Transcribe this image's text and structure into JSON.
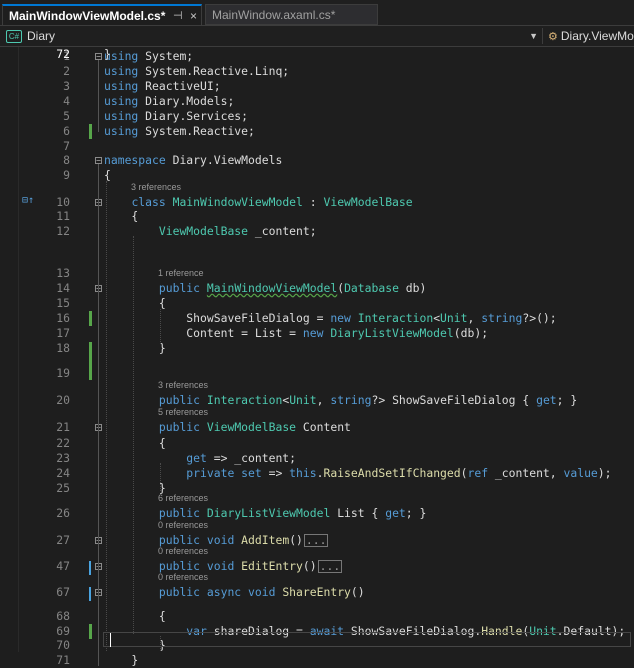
{
  "tabs": [
    {
      "title": "MainWindowViewModel.cs*",
      "pin": "⊣",
      "close": "×"
    },
    {
      "title": "MainWindow.axaml.cs*"
    }
  ],
  "nav": {
    "project": "Diary",
    "project_icon": "C#",
    "member": "Diary.ViewModels"
  },
  "code_lines": [
    {
      "n": "1",
      "parts": [
        [
          "kw",
          "using"
        ],
        [
          "pl",
          " System;"
        ]
      ]
    },
    {
      "n": "2",
      "parts": [
        [
          "kw",
          "using"
        ],
        [
          "pl",
          " System.Reactive.Linq;"
        ]
      ]
    },
    {
      "n": "3",
      "parts": [
        [
          "kw",
          "using"
        ],
        [
          "pl",
          " ReactiveUI;"
        ]
      ]
    },
    {
      "n": "4",
      "parts": [
        [
          "kw",
          "using"
        ],
        [
          "pl",
          " Diary.Models;"
        ]
      ]
    },
    {
      "n": "5",
      "parts": [
        [
          "kw",
          "using"
        ],
        [
          "pl",
          " Diary.Services;"
        ]
      ]
    },
    {
      "n": "6",
      "parts": [
        [
          "kw",
          "using"
        ],
        [
          "pl",
          " System.Reactive;"
        ]
      ]
    },
    {
      "n": "7",
      "parts": []
    },
    {
      "n": "8",
      "parts": [
        [
          "kw",
          "namespace"
        ],
        [
          "pl",
          " Diary.ViewModels"
        ]
      ]
    },
    {
      "n": "9",
      "parts": [
        [
          "pl",
          "{"
        ]
      ]
    },
    {
      "n": "10",
      "lens": "3 references",
      "parts": [
        [
          "pl",
          "    "
        ],
        [
          "kw",
          "class "
        ],
        [
          "ty",
          "MainWindowViewModel"
        ],
        [
          "pl",
          " : "
        ],
        [
          "ty",
          "ViewModelBase"
        ]
      ]
    },
    {
      "n": "11",
      "parts": [
        [
          "pl",
          "    {"
        ]
      ]
    },
    {
      "n": "12",
      "parts": [
        [
          "pl",
          "        "
        ],
        [
          "ty",
          "ViewModelBase"
        ],
        [
          "pl",
          " _content;"
        ]
      ]
    },
    {
      "n": "13",
      "parts": []
    },
    {
      "n": "14",
      "lens": "1 reference",
      "parts": [
        [
          "pl",
          "        "
        ],
        [
          "kw",
          "public "
        ],
        [
          "ty sq",
          "MainWindowViewModel"
        ],
        [
          "pl",
          "("
        ],
        [
          "ty",
          "Database"
        ],
        [
          "pl",
          " db)"
        ]
      ]
    },
    {
      "n": "15",
      "parts": [
        [
          "pl",
          "        {"
        ]
      ]
    },
    {
      "n": "16",
      "parts": [
        [
          "pl",
          "            ShowSaveFileDialog = "
        ],
        [
          "kw",
          "new "
        ],
        [
          "ty",
          "Interaction"
        ],
        [
          "pl",
          "<"
        ],
        [
          "ty",
          "Unit"
        ],
        [
          "pl",
          ", "
        ],
        [
          "kw",
          "string"
        ],
        [
          "pl",
          "?>();"
        ]
      ]
    },
    {
      "n": "17",
      "parts": [
        [
          "pl",
          "            Content = List = "
        ],
        [
          "kw",
          "new "
        ],
        [
          "ty",
          "DiaryListViewModel"
        ],
        [
          "pl",
          "(db);"
        ]
      ]
    },
    {
      "n": "18",
      "parts": [
        [
          "pl",
          "        }"
        ]
      ]
    },
    {
      "n": "19",
      "parts": []
    },
    {
      "n": "20",
      "lens": "3 references",
      "parts": [
        [
          "pl",
          "        "
        ],
        [
          "kw",
          "public "
        ],
        [
          "ty",
          "Interaction"
        ],
        [
          "pl",
          "<"
        ],
        [
          "ty",
          "Unit"
        ],
        [
          "pl",
          ", "
        ],
        [
          "kw",
          "string"
        ],
        [
          "pl",
          "?> ShowSaveFileDialog { "
        ],
        [
          "kw",
          "get"
        ],
        [
          "pl",
          "; }"
        ]
      ]
    },
    {
      "n": "21",
      "lens": "5 references",
      "parts": [
        [
          "pl",
          "        "
        ],
        [
          "kw",
          "public "
        ],
        [
          "ty",
          "ViewModelBase"
        ],
        [
          "pl",
          " Content"
        ]
      ]
    },
    {
      "n": "22",
      "parts": [
        [
          "pl",
          "        {"
        ]
      ]
    },
    {
      "n": "23",
      "parts": [
        [
          "pl",
          "            "
        ],
        [
          "kw",
          "get"
        ],
        [
          "pl",
          " => _content;"
        ]
      ]
    },
    {
      "n": "24",
      "parts": [
        [
          "pl",
          "            "
        ],
        [
          "kw",
          "private set"
        ],
        [
          "pl",
          " => "
        ],
        [
          "kw",
          "this"
        ],
        [
          "pl",
          "."
        ],
        [
          "fn",
          "RaiseAndSetIfChanged"
        ],
        [
          "pl",
          "("
        ],
        [
          "kw",
          "ref"
        ],
        [
          "pl",
          " _content, "
        ],
        [
          "kw",
          "value"
        ],
        [
          "pl",
          ");"
        ]
      ]
    },
    {
      "n": "25",
      "parts": [
        [
          "pl",
          "        }"
        ]
      ]
    },
    {
      "n": "26",
      "lens": "6 references",
      "parts": [
        [
          "pl",
          "        "
        ],
        [
          "kw",
          "public "
        ],
        [
          "ty",
          "DiaryListViewModel"
        ],
        [
          "pl",
          " List { "
        ],
        [
          "kw",
          "get"
        ],
        [
          "pl",
          "; }"
        ]
      ]
    },
    {
      "n": "27",
      "lens": "0 references",
      "parts": [
        [
          "pl",
          "        "
        ],
        [
          "kw",
          "public void "
        ],
        [
          "fn",
          "AddItem"
        ],
        [
          "pl",
          "()"
        ],
        [
          "coll",
          "..."
        ]
      ]
    },
    {
      "n": "47",
      "lens": "0 references",
      "parts": [
        [
          "pl",
          "        "
        ],
        [
          "kw",
          "public void "
        ],
        [
          "fn",
          "EditEntry"
        ],
        [
          "pl",
          "()"
        ],
        [
          "coll",
          "..."
        ]
      ]
    },
    {
      "n": "67",
      "lens": "0 references",
      "parts": [
        [
          "pl",
          "        "
        ],
        [
          "kw",
          "public async void "
        ],
        [
          "fn",
          "ShareEntry"
        ],
        [
          "pl",
          "()"
        ]
      ]
    },
    {
      "n": "68",
      "parts": [
        [
          "pl",
          "        {"
        ]
      ]
    },
    {
      "n": "69",
      "parts": [
        [
          "pl",
          "            "
        ],
        [
          "kw",
          "var"
        ],
        [
          "pl",
          " shareDialog = "
        ],
        [
          "kw",
          "await"
        ],
        [
          "pl",
          " ShowSaveFileDialog."
        ],
        [
          "fn",
          "Handle"
        ],
        [
          "pl",
          "("
        ],
        [
          "ty",
          "Unit"
        ],
        [
          "pl",
          ".Default);"
        ]
      ]
    },
    {
      "n": "70",
      "parts": [
        [
          "pl",
          "        }"
        ]
      ]
    },
    {
      "n": "71",
      "parts": [
        [
          "pl",
          "    }"
        ]
      ]
    },
    {
      "n": "72",
      "parts": [
        [
          "pl",
          "}"
        ]
      ]
    }
  ],
  "colors": {
    "keyword": "#569cd6",
    "type": "#4ec9b0",
    "method": "#dcdcaa",
    "text": "#dcdcdc",
    "line_number": "#858585",
    "change_bar": "#57a64a",
    "accent": "#0078d4"
  }
}
